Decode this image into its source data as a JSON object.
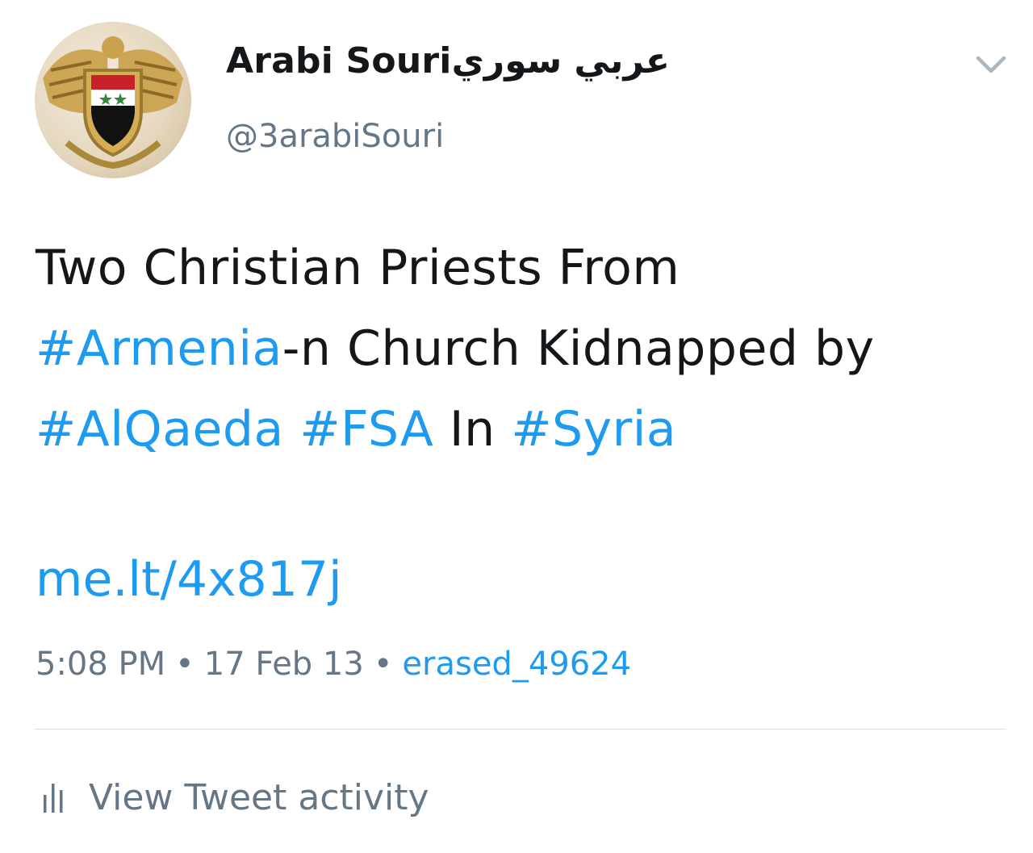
{
  "user": {
    "display_name_latin": "Arabi Souri",
    "display_name_arabic": "عربي سوري",
    "handle": "@3arabiSouri",
    "avatar_icon": "syrian-eagle-emblem-icon"
  },
  "tweet": {
    "line1": "Two Christian Priests From",
    "hashtag_armenia": "#Armenia",
    "line2_rest": "-n Church Kidnapped by",
    "hashtag_alqaeda": "#AlQaeda",
    "hashtag_fsa": "#FSA",
    "word_in": "In",
    "hashtag_syria": "#Syria",
    "link": "me.lt/4x817j"
  },
  "meta": {
    "time": "5:08 PM",
    "date": "17 Feb 13",
    "separator": "•",
    "source": "erased_49624"
  },
  "actions": {
    "view_activity_label": "View Tweet activity",
    "activity_icon": "bar-chart-icon",
    "menu_icon": "chevron-down-icon"
  },
  "colors": {
    "link": "#1d9bf0",
    "secondary_text": "#657786",
    "primary_text": "#14171a",
    "divider": "#d9dee3"
  }
}
